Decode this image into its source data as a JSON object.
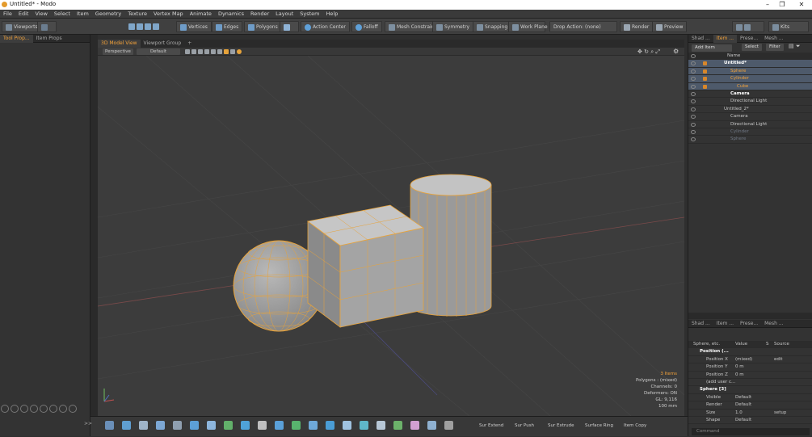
{
  "window": {
    "title": "Untitled* - Modo"
  },
  "menu": [
    "File",
    "Edit",
    "View",
    "Select",
    "Item",
    "Geometry",
    "Texture",
    "Vertex Map",
    "Animate",
    "Dynamics",
    "Render",
    "Layout",
    "System",
    "Help"
  ],
  "toolbar": {
    "viewports": "Viewports",
    "vertices": "Vertices",
    "edges": "Edges",
    "polygons": "Polygons",
    "action_center": "Action Center",
    "falloff": "Falloff",
    "mesh_constraint": "Mesh Constraint",
    "symmetry": "Symmetry",
    "snapping": "Snapping",
    "work_plane": "Work Plane",
    "drop_action": "Drop Action: (none)",
    "render": "Render",
    "preview": "Preview",
    "kits": "Kits"
  },
  "left_panel": {
    "tabs": [
      "Tool Prop...",
      "Item Props"
    ]
  },
  "viewport": {
    "tabs": [
      "3D Model View",
      "Viewport Group"
    ],
    "view_mode": "Perspective",
    "shading": "Default",
    "info": [
      "3 Items",
      "Polygons : (mixed)",
      "Channels: 0",
      "Deformers: ON",
      "GL: 9,116",
      "100 mm"
    ]
  },
  "item_list": {
    "tabs": [
      "Shad ...",
      "Item ...",
      "Prese...",
      "Mesh ..."
    ],
    "add_item": "Add Item",
    "select": "Select",
    "filter": "Filter",
    "header": "Name",
    "rows": [
      {
        "label": "Untitled*",
        "indent": 0,
        "style": "bold",
        "selected": true
      },
      {
        "label": "Sphere",
        "indent": 1,
        "style": "orange",
        "selected": true
      },
      {
        "label": "Cylinder",
        "indent": 1,
        "style": "orange",
        "selected": true
      },
      {
        "label": "Cube",
        "indent": 2,
        "style": "orange",
        "selected": true
      },
      {
        "label": "Camera",
        "indent": 1,
        "style": "bold",
        "selected": false
      },
      {
        "label": "Directional Light",
        "indent": 1,
        "style": "normal",
        "selected": false
      },
      {
        "label": "Untitled_2*",
        "indent": 0,
        "style": "normal",
        "selected": false
      },
      {
        "label": "Camera",
        "indent": 1,
        "style": "normal",
        "selected": false
      },
      {
        "label": "Directional Light",
        "indent": 1,
        "style": "normal",
        "selected": false
      },
      {
        "label": "Cylinder",
        "indent": 1,
        "style": "dim",
        "selected": false
      },
      {
        "label": "Sphere",
        "indent": 1,
        "style": "dim",
        "selected": false
      }
    ]
  },
  "properties": {
    "tabs": [
      "Shad ...",
      "Item ...",
      "Prese...",
      "Mesh ..."
    ],
    "headers": [
      "Sphere, etc.",
      "Value",
      "S",
      "Source"
    ],
    "rows": [
      {
        "name": "Position (...",
        "value": "",
        "source": "",
        "bold": true
      },
      {
        "name": "Position X",
        "value": "(mixed)",
        "source": "edit",
        "bold": false
      },
      {
        "name": "Position Y",
        "value": "0 m",
        "source": "",
        "bold": false
      },
      {
        "name": "Position Z",
        "value": "0 m",
        "source": "",
        "bold": false
      },
      {
        "name": "(add user c...",
        "value": "",
        "source": "",
        "bold": false
      },
      {
        "name": "Sphere  [3]",
        "value": "",
        "source": "",
        "bold": true
      },
      {
        "name": "Visible",
        "value": "Default",
        "source": "",
        "bold": false
      },
      {
        "name": "Render",
        "value": "Default",
        "source": "",
        "bold": false
      },
      {
        "name": "Size",
        "value": "1.0",
        "source": "setup",
        "bold": false
      },
      {
        "name": "Shape",
        "value": "Default",
        "source": "",
        "bold": false
      }
    ],
    "command_placeholder": "Command"
  },
  "bottom": {
    "buttons": [
      "Sur Extend",
      "Sur Push",
      "Sur Extrude",
      "Surface Ring",
      "Item Copy"
    ]
  }
}
